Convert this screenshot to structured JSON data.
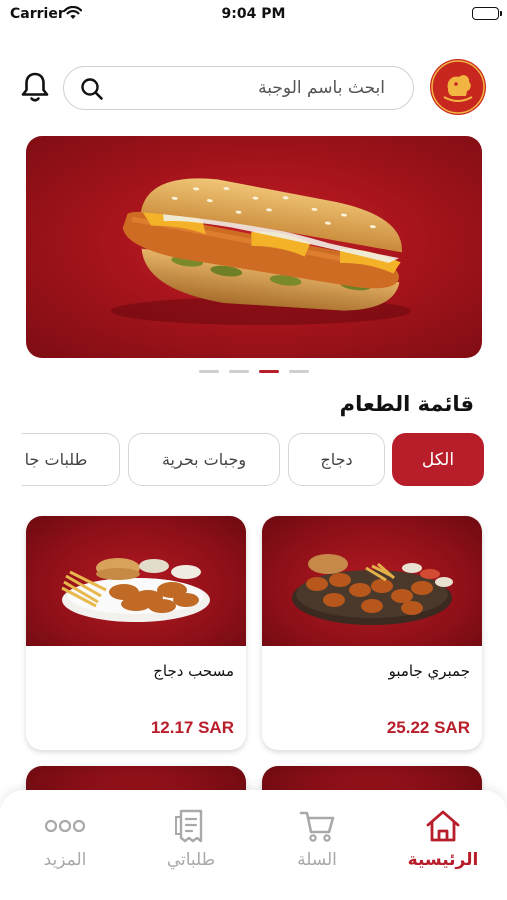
{
  "status_bar": {
    "carrier": "Carrier",
    "time": "9:04 PM"
  },
  "header": {
    "search_placeholder": "ابحث باسم الوجبة"
  },
  "banner": {
    "slide_count": 4,
    "active_slide": 3
  },
  "menu": {
    "title": "قائمة الطعام",
    "categories": [
      {
        "label": "الكل",
        "active": true
      },
      {
        "label": "دجاج",
        "active": false
      },
      {
        "label": "وجبات بحرية",
        "active": false
      },
      {
        "label": "طلبات جا",
        "active": false
      }
    ]
  },
  "products": [
    {
      "name": "جمبري جامبو",
      "price": "25.22 SAR"
    },
    {
      "name": "مسحب دجاج",
      "price": "12.17 SAR"
    }
  ],
  "bottom_nav": [
    {
      "label": "الرئيسية",
      "icon": "home-icon",
      "active": true
    },
    {
      "label": "السلة",
      "icon": "cart-icon",
      "active": false
    },
    {
      "label": "طلباتي",
      "icon": "receipt-icon",
      "active": false
    },
    {
      "label": "المزيد",
      "icon": "more-icon",
      "active": false
    }
  ],
  "colors": {
    "accent": "#b81d2a",
    "banner": "#a8141c",
    "inactive": "#a9a9a9"
  }
}
